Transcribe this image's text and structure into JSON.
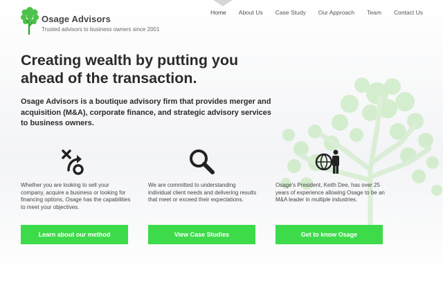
{
  "brand": {
    "name": "Osage Advisors",
    "tagline": "Trusted advisors to business owners since 2001"
  },
  "nav": {
    "items": [
      {
        "label": "Home",
        "active": true
      },
      {
        "label": "About Us",
        "active": false
      },
      {
        "label": "Case Study",
        "active": false
      },
      {
        "label": "Our Approach",
        "active": false
      },
      {
        "label": "Team",
        "active": false
      },
      {
        "label": "Contact Us",
        "active": false
      }
    ]
  },
  "hero": {
    "headline": "Creating wealth by putting you ahead of the transaction.",
    "lede": "Osage Advisors is a boutique advisory firm that provides merger and acquisition (M&A), corporate finance, and strategic advisory services to business owners."
  },
  "columns": [
    {
      "icon": "strategy-icon",
      "text": "Whether you are looking to sell your company, acquire a business or looking for financing options, Osage has the capabilities to meet your objectives.",
      "button": "Learn about our method"
    },
    {
      "icon": "magnifier-icon",
      "text": "We are committed to understanding individual client needs and delivering results that meet or exceed their expectations.",
      "button": "View Case Studies"
    },
    {
      "icon": "globe-person-icon",
      "text": "Osage's President, Keith Dee, has over 25 years of experience allowing Osage to be an M&A leader in multiple industries.",
      "button": "Get to know Osage"
    }
  ],
  "colors": {
    "accent": "#3ddb4a",
    "logo_green": "#4cc24a",
    "text_dark": "#2a2a2a"
  }
}
